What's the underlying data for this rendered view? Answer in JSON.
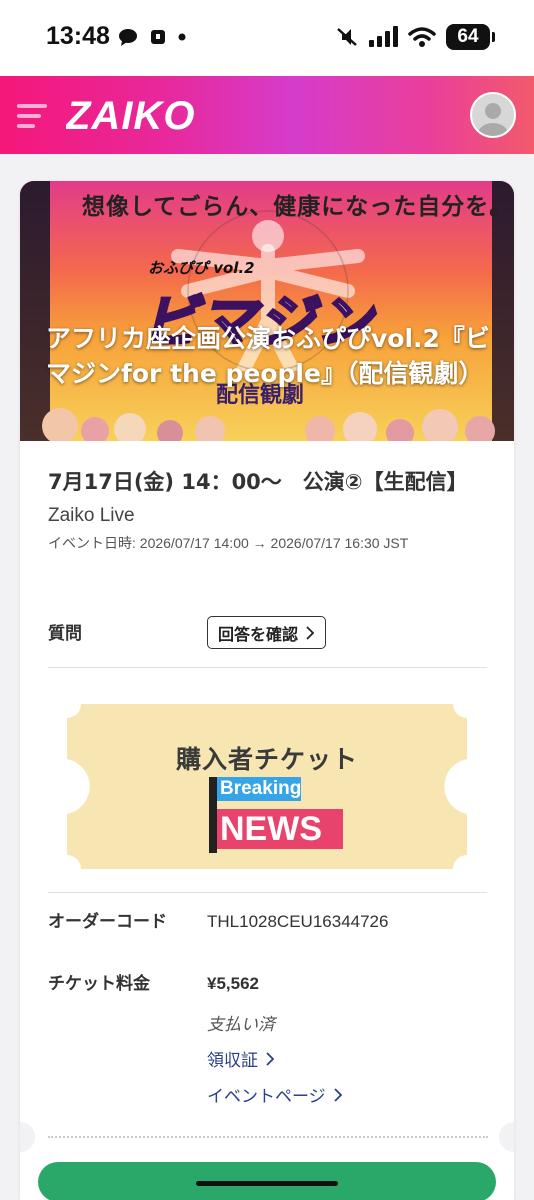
{
  "status_bar": {
    "time": "13:48",
    "battery": "64"
  },
  "header": {
    "brand": "ZAIKO"
  },
  "event": {
    "banner_tagline": "想像してごらん、健康になった自分を。",
    "banner_series": "おふぴぴ vol.2",
    "banner_logo": "ビマジン",
    "banner_stream": "配信観劇",
    "title": "アフリカ座企画公演おふぴぴvol.2『ビマジンfor the people』（配信観劇）",
    "performance": "7月17日(金) 14：00〜　公演②【生配信】",
    "venue": "Zaiko Live",
    "dates": "イベント日時: 2026/07/17 14:00 → 2026/07/17 16:30 JST"
  },
  "question": {
    "label": "質問",
    "button_label": "回答を確認"
  },
  "ticket": {
    "title": "購入者チケット",
    "badge_top": "Breaking",
    "badge_bottom": "NEWS"
  },
  "order": {
    "code_label": "オーダーコード",
    "code_value": "THL1028CEU16344726",
    "price_label": "チケット料金",
    "price_value": "¥5,562",
    "status": "支払い済",
    "receipt_link": "領収証",
    "event_page_link": "イベントページ"
  },
  "colors": {
    "header_gradient_start": "#f5177a",
    "header_gradient_end": "#f35a6c",
    "ticket_fill": "#f7e5b2",
    "link": "#2b3f8c",
    "primary_button": "#2aa86a"
  }
}
